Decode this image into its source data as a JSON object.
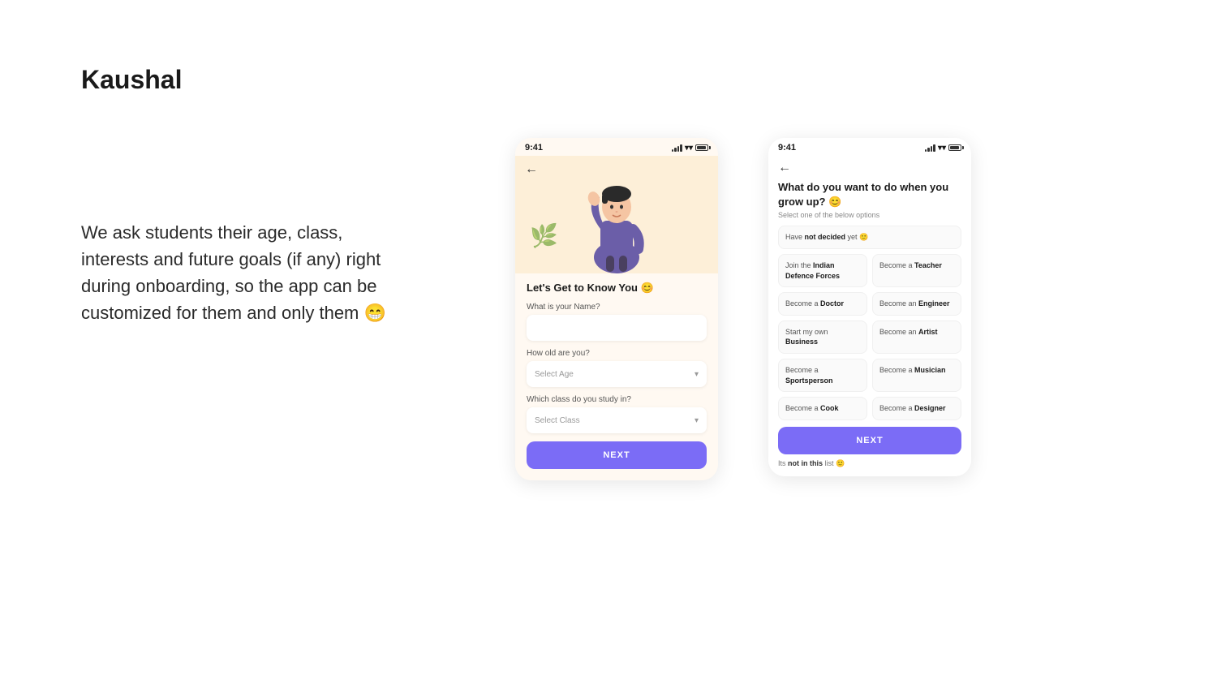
{
  "brand": {
    "title": "Kaushal"
  },
  "description": {
    "text": "We ask students their age, class, interests and future goals (if any) right during onboarding, so the app can be customized for them and only them 😁"
  },
  "phone1": {
    "status_time": "9:41",
    "back_label": "←",
    "greeting": "Let's Get to Know You 😊",
    "name_label": "What is your Name?",
    "age_label": "How old are you?",
    "age_placeholder": "Select Age",
    "class_label": "Which class do you study in?",
    "class_placeholder": "Select Class",
    "next_btn": "NEXT"
  },
  "phone2": {
    "status_time": "9:41",
    "back_label": "←",
    "question": "What do you want to do when you grow up? 😊",
    "subtitle": "Select one of the below options",
    "options": [
      {
        "pre": "Have ",
        "bold": "not decided",
        "post": " yet 🙂",
        "full": true
      },
      {
        "pre": "Join the ",
        "bold": "Indian Defence Forces",
        "post": "",
        "full": false
      },
      {
        "pre": "Become a ",
        "bold": "Teacher",
        "post": "",
        "full": false
      },
      {
        "pre": "Become a ",
        "bold": "Doctor",
        "post": "",
        "full": false
      },
      {
        "pre": "Become an ",
        "bold": "Engineer",
        "post": "",
        "full": false
      },
      {
        "pre": "Start my own ",
        "bold": "Business",
        "post": "",
        "full": false
      },
      {
        "pre": "Become an ",
        "bold": "Artist",
        "post": "",
        "full": false
      },
      {
        "pre": "Become a ",
        "bold": "Sportsperson",
        "post": "",
        "full": false
      },
      {
        "pre": "Become a ",
        "bold": "Musician",
        "post": "",
        "full": false
      },
      {
        "pre": "Become a ",
        "bold": "Cook",
        "post": "",
        "full": false
      },
      {
        "pre": "Become a ",
        "bold": "Designer",
        "post": "",
        "full": false
      }
    ],
    "next_btn": "NEXT",
    "not_in_list_pre": "Its ",
    "not_in_list_bold": "not in this",
    "not_in_list_post": " list 🙂"
  }
}
